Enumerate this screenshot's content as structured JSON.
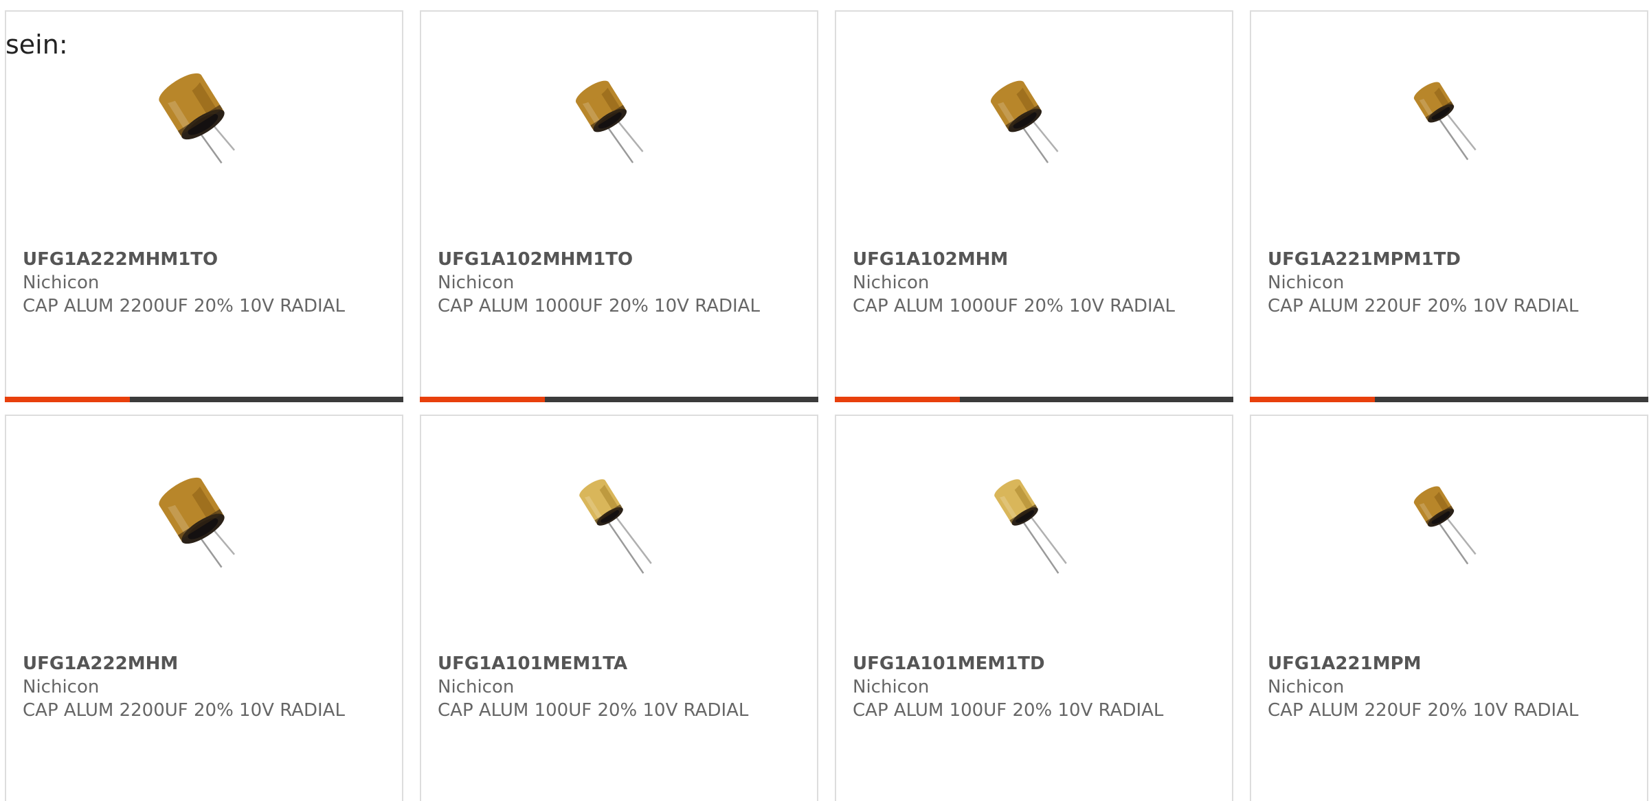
{
  "intro_text": "sein:",
  "colors": {
    "accent": "#e8400c",
    "bar_dark": "#3b3b3b",
    "card_border": "#dddddd",
    "text_muted": "#666666"
  },
  "products": [
    {
      "part_number": "UFG1A222MHM1TO",
      "manufacturer": "Nichicon",
      "description": "CAP ALUM 2200UF 20% 10V RADIAL",
      "image_icon": "capacitor-large-image"
    },
    {
      "part_number": "UFG1A102MHM1TO",
      "manufacturer": "Nichicon",
      "description": "CAP ALUM 1000UF 20% 10V RADIAL",
      "image_icon": "capacitor-medium-image"
    },
    {
      "part_number": "UFG1A102MHM",
      "manufacturer": "Nichicon",
      "description": "CAP ALUM 1000UF 20% 10V RADIAL",
      "image_icon": "capacitor-medium-image"
    },
    {
      "part_number": "UFG1A221MPM1TD",
      "manufacturer": "Nichicon",
      "description": "CAP ALUM 220UF 20% 10V RADIAL",
      "image_icon": "capacitor-small-image"
    },
    {
      "part_number": "UFG1A222MHM",
      "manufacturer": "Nichicon",
      "description": "CAP ALUM 2200UF 20% 10V RADIAL",
      "image_icon": "capacitor-large-image"
    },
    {
      "part_number": "UFG1A101MEM1TA",
      "manufacturer": "Nichicon",
      "description": "CAP ALUM 100UF 20% 10V RADIAL",
      "image_icon": "capacitor-slim-image"
    },
    {
      "part_number": "UFG1A101MEM1TD",
      "manufacturer": "Nichicon",
      "description": "CAP ALUM 100UF 20% 10V RADIAL",
      "image_icon": "capacitor-slim-image"
    },
    {
      "part_number": "UFG1A221MPM",
      "manufacturer": "Nichicon",
      "description": "CAP ALUM 220UF 20% 10V RADIAL",
      "image_icon": "capacitor-small-image"
    }
  ]
}
